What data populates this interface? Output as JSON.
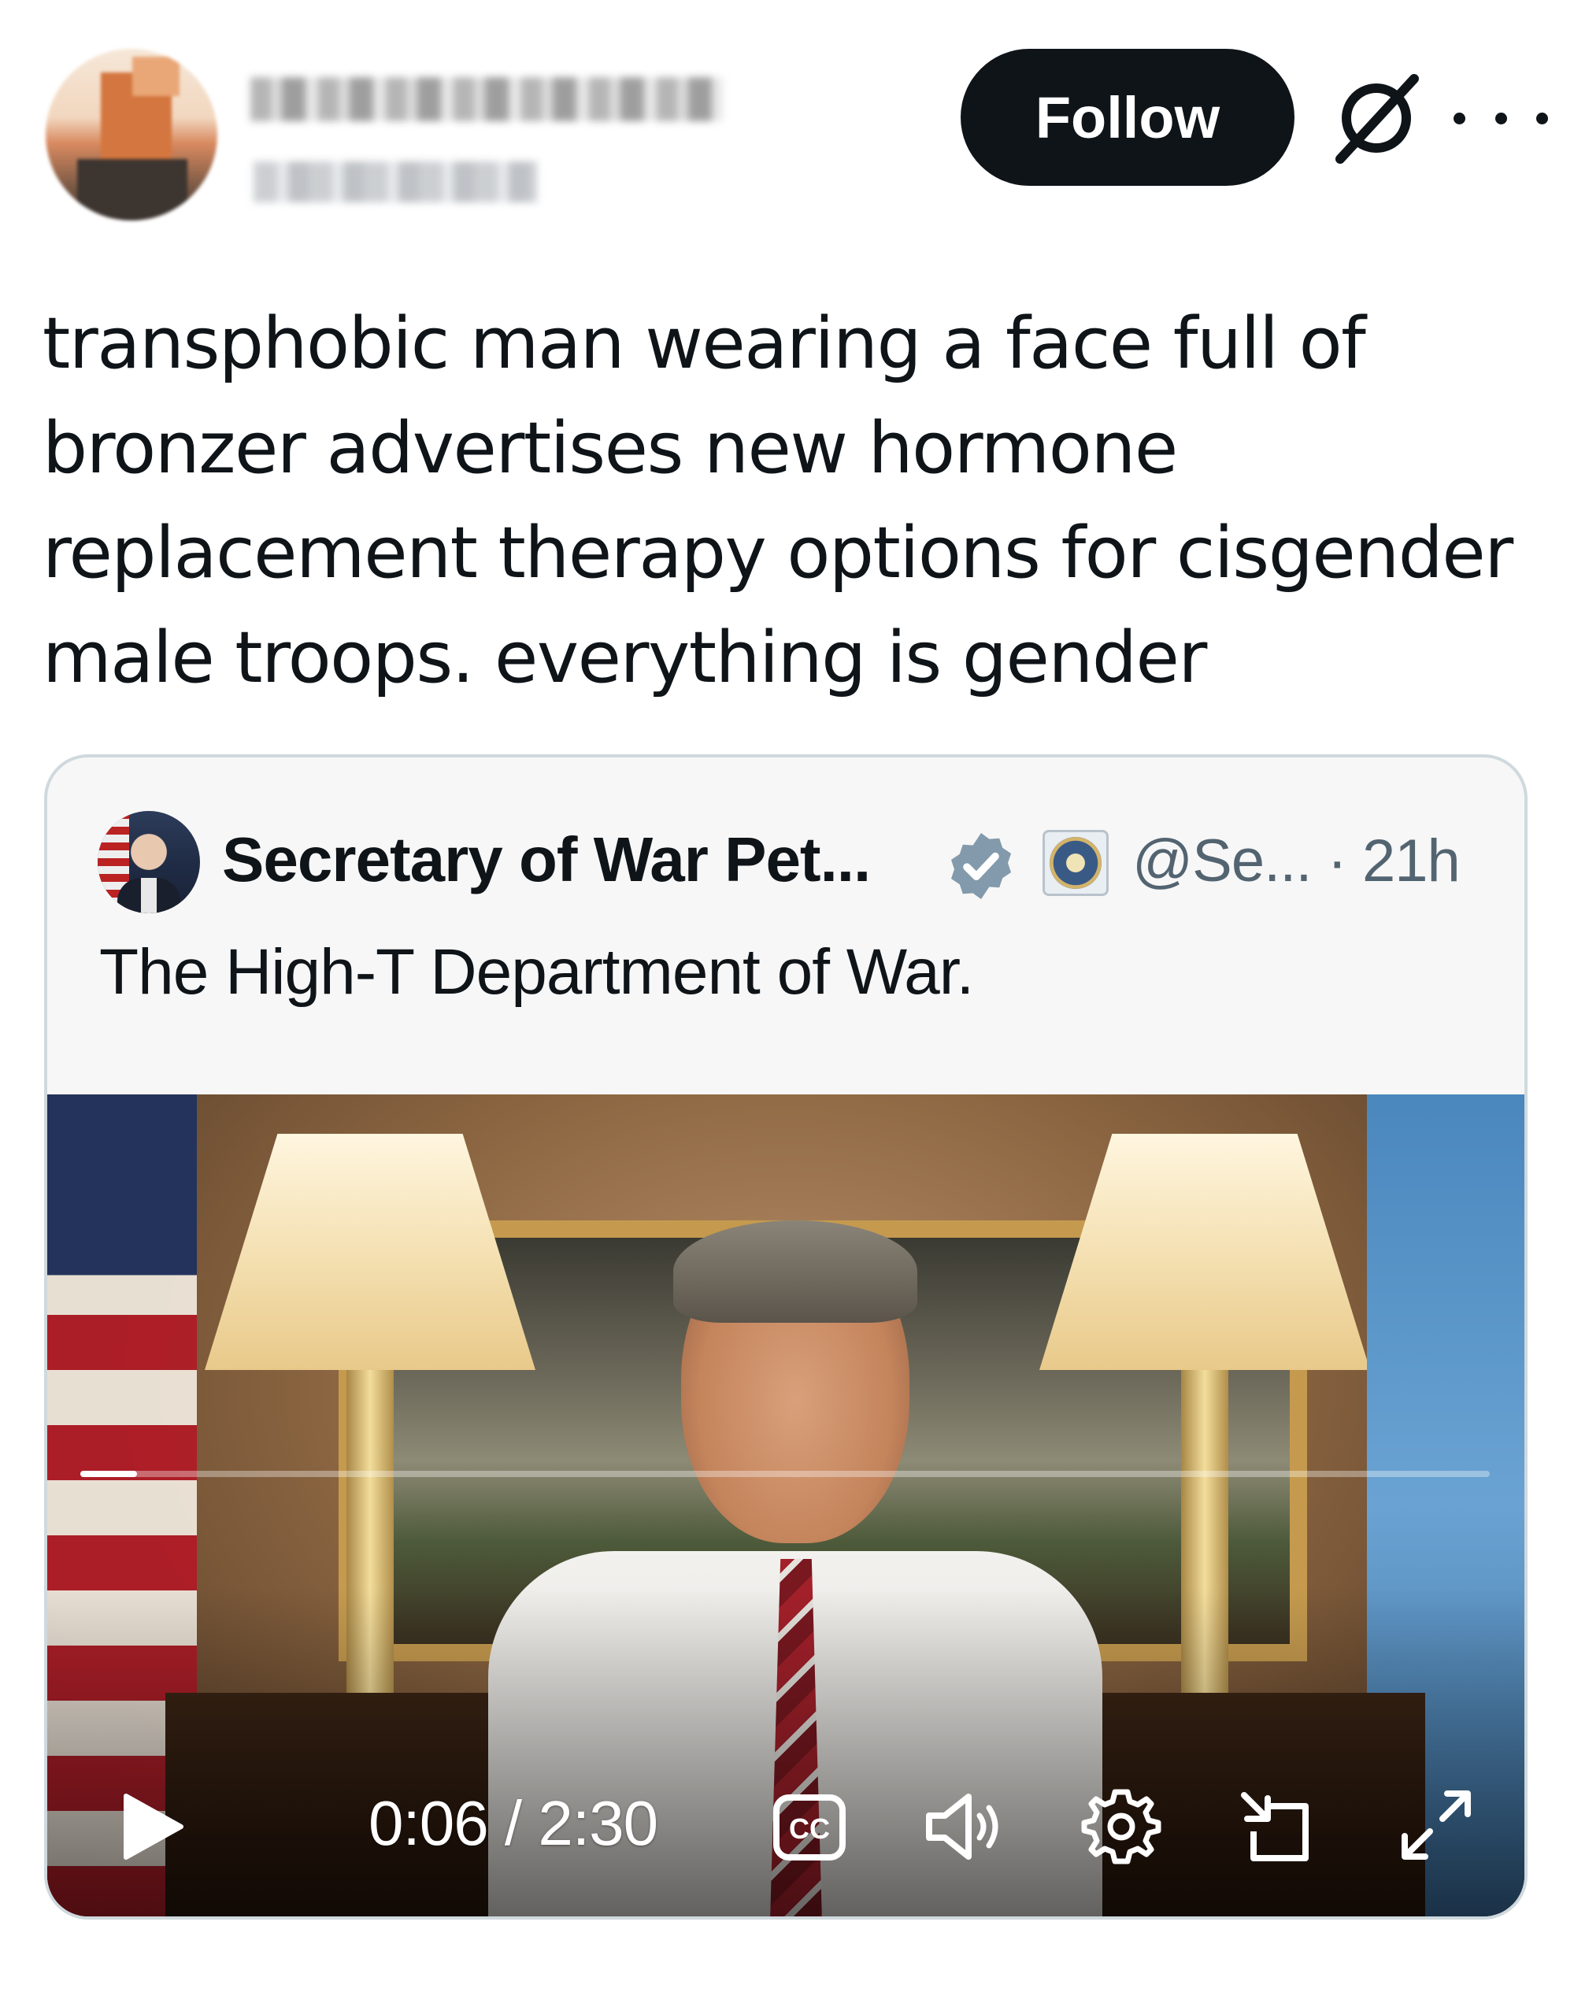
{
  "header": {
    "follow_label": "Follow"
  },
  "tweet": {
    "text": "transphobic man wearing a face full of bronzer advertises new hormone replacement therapy options for cisgender male troops. everything is gender"
  },
  "quoted": {
    "author_name": "Secretary of War Pet...",
    "handle_time": "@Se... · 21h",
    "text": "The High-T Department of War."
  },
  "video": {
    "time_display": "0:06 / 2:30",
    "progress": 0.04
  },
  "icons": {
    "grok": "grok-icon",
    "more": "more-icon",
    "verified": "verified-badge-icon",
    "affiliate": "affiliate-seal-icon",
    "play": "play-icon",
    "captions": "cc-icon",
    "volume": "volume-icon",
    "settings": "gear-icon",
    "pip": "picture-in-picture-icon",
    "fullscreen": "expand-icon"
  },
  "colors": {
    "follow_bg": "#0f1419",
    "verified": "#829aab",
    "muted_text": "#536471",
    "card_border": "#cfd9de"
  }
}
